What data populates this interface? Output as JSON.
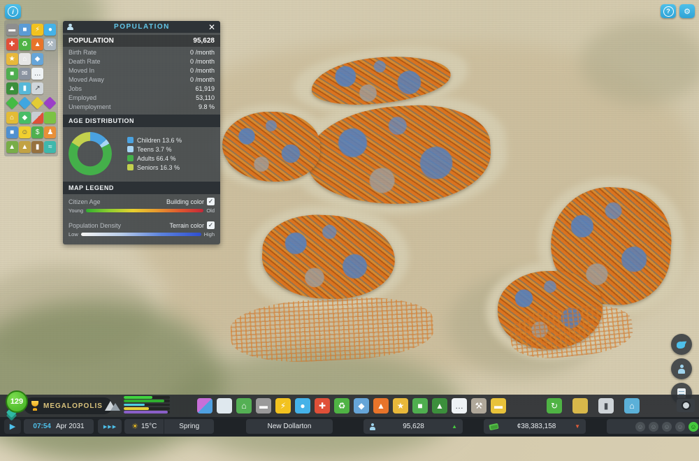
{
  "accent": "#3fb6e3",
  "icons": {
    "info": "i",
    "help": "?",
    "settings": "⚙",
    "close": "✕",
    "play": "▶",
    "sun": "☀",
    "up": "▲",
    "down": "▼",
    "check": "✓",
    "smiley": "☺"
  },
  "panel": {
    "title": "POPULATION",
    "stats": [
      {
        "label": "POPULATION",
        "value": "95,628",
        "emphasis": true
      },
      {
        "label": "Birth Rate",
        "value": "0 /month"
      },
      {
        "label": "Death Rate",
        "value": "0 /month"
      },
      {
        "label": "Moved In",
        "value": "0 /month"
      },
      {
        "label": "Moved Away",
        "value": "0 /month"
      },
      {
        "label": "Jobs",
        "value": "61,919"
      },
      {
        "label": "Employed",
        "value": "53,110"
      },
      {
        "label": "Unemployment",
        "value": "9.8 %"
      }
    ],
    "age_section_title": "AGE DISTRIBUTION",
    "map_legend_title": "MAP LEGEND",
    "citizen_age": {
      "label": "Citizen Age",
      "toggle_label": "Building color",
      "checked": true,
      "min": "Young",
      "max": "Old"
    },
    "population_density": {
      "label": "Population Density",
      "toggle_label": "Terrain color",
      "checked": true,
      "min": "Low",
      "max": "High"
    }
  },
  "chart_data": {
    "type": "pie",
    "title": "AGE DISTRIBUTION",
    "segments": [
      {
        "label": "Children",
        "value": 13.6,
        "value_text": "13.6 %",
        "color": "#4aa2e0"
      },
      {
        "label": "Teens",
        "value": 3.7,
        "value_text": "3.7 %",
        "color": "#a9d6f5"
      },
      {
        "label": "Adults",
        "value": 66.4,
        "value_text": "66.4 %",
        "color": "#44b04a"
      },
      {
        "label": "Seniors",
        "value": 16.3,
        "value_text": "16.3 %",
        "color": "#c3d14d"
      }
    ]
  },
  "infoview_toolbar": {
    "items": [
      {
        "name": "roads-infoview",
        "color": "#8e8e8e",
        "glyph": "▬"
      },
      {
        "name": "electronics-infoview",
        "color": "#5b9bd5",
        "glyph": "■"
      },
      {
        "name": "electricity-infoview",
        "color": "#f2c21f",
        "glyph": "⚡"
      },
      {
        "name": "water-infoview",
        "color": "#45b2e8",
        "glyph": "●"
      },
      {
        "name": "healthcare-infoview",
        "color": "#e05038",
        "glyph": "✚"
      },
      {
        "name": "garbage-infoview",
        "color": "#4fb344",
        "glyph": "♻"
      },
      {
        "name": "fire-infoview",
        "color": "#e8742a",
        "glyph": "▲"
      },
      {
        "name": "maintenance-infoview",
        "color": "#aab6bf",
        "glyph": "⚒"
      },
      {
        "name": "police-infoview",
        "color": "#e8b83a",
        "glyph": "★"
      },
      {
        "name": "administration-infoview",
        "color": "#e6e6e6",
        "glyph": "⌂"
      },
      {
        "name": "education-infoview",
        "color": "#66a5d8",
        "glyph": "◆"
      },
      {
        "empty": true
      },
      {
        "name": "transportation-infoview",
        "color": "#4fae4f",
        "glyph": "■"
      },
      {
        "name": "post-infoview",
        "color": "#8a93a0",
        "glyph": "✉"
      },
      {
        "name": "telecom-infoview",
        "color": "#eef2f4",
        "glyph": "…",
        "dark": true
      },
      {
        "empty": true
      },
      {
        "name": "parks-infoview",
        "color": "#3c8f3c",
        "glyph": "▲"
      },
      {
        "name": "battery-infoview",
        "color": "#56b8d8",
        "glyph": "▮"
      },
      {
        "name": "outside-connections-infoview",
        "color": "#d0d6da",
        "glyph": "↗",
        "dark": true
      },
      {
        "empty": true
      },
      {
        "name": "land-map-infoview",
        "color": "#44bb44",
        "shape": "diamond"
      },
      {
        "name": "water-map-infoview",
        "color": "#3fa6e0",
        "shape": "diamond"
      },
      {
        "name": "pollution-map-infoview",
        "color": "#e3cc35",
        "shape": "diamond"
      },
      {
        "name": "noise-map-infoview",
        "color": "#9b3fc8",
        "shape": "diamond"
      },
      {
        "name": "residential-infoview",
        "color": "#e3bb35",
        "glyph": "⌂"
      },
      {
        "name": "land-value-infoview",
        "color": "#48bd66",
        "glyph": "◆"
      },
      {
        "name": "growth-infoview",
        "color": "#c8cdd2",
        "color2": "#e05038",
        "glyph": ""
      },
      {
        "name": "greenery-infoview",
        "color": "#7cc244",
        "glyph": ""
      },
      {
        "name": "tourism-infoview",
        "color": "#5090d0",
        "glyph": "■"
      },
      {
        "name": "happiness-infoview",
        "color": "#f0cf2f",
        "glyph": "☺",
        "dark": true
      },
      {
        "name": "economy-infoview",
        "color": "#4fb04f",
        "glyph": "$"
      },
      {
        "name": "population-infoview",
        "color": "#e89038",
        "glyph": "♟"
      },
      {
        "name": "terrain-infoview",
        "color": "#78ad48",
        "glyph": "▲"
      },
      {
        "name": "desert-infoview",
        "color": "#c2a244",
        "glyph": "▲"
      },
      {
        "name": "resources-infoview",
        "color": "#96713f",
        "glyph": "▮"
      },
      {
        "name": "water-resources-infoview",
        "color": "#3fb8ac",
        "glyph": "≈"
      }
    ]
  },
  "bottom_toolbar": {
    "group1": [
      {
        "name": "zones-tool",
        "color": "#c86fd8",
        "color2": "#4fa0e0"
      },
      {
        "name": "zoning-tool",
        "color": "#dfe8ee",
        "shape": "diamond"
      },
      {
        "name": "signature-buildings-tool",
        "color": "#54b054",
        "glyph": "⌂"
      },
      {
        "name": "roads-tool",
        "color": "#9a9a9a",
        "glyph": "▬"
      },
      {
        "name": "electricity-tool",
        "color": "#f2c21f",
        "glyph": "⚡"
      },
      {
        "name": "water-tool",
        "color": "#45b2e8",
        "glyph": "●"
      },
      {
        "name": "healthcare-tool",
        "color": "#e05038",
        "glyph": "✚"
      },
      {
        "name": "garbage-tool",
        "color": "#4fb344",
        "glyph": "♻"
      },
      {
        "name": "education-tool",
        "color": "#66a5d8",
        "glyph": "◆"
      },
      {
        "name": "fire-tool",
        "color": "#e8742a",
        "glyph": "▲"
      },
      {
        "name": "police-tool",
        "color": "#e8b83a",
        "glyph": "★"
      },
      {
        "name": "transportation-tool",
        "color": "#4fae4f",
        "glyph": "■"
      },
      {
        "name": "parks-tool",
        "color": "#3c8f3c",
        "glyph": "▲"
      },
      {
        "name": "communications-tool",
        "color": "#eef2f4",
        "glyph": "…",
        "dark": true
      },
      {
        "name": "landscaping-tool",
        "color": "#b0a89a",
        "glyph": "⚒"
      },
      {
        "name": "bulldozer-tool",
        "color": "#e8c23a",
        "glyph": "▬"
      }
    ],
    "group2": [
      {
        "name": "economy-menu",
        "color": "#4fb344",
        "glyph": "↻"
      },
      {
        "name": "progression-menu",
        "color": "#d8b84a",
        "shape": "diamond"
      },
      {
        "name": "statistics-menu",
        "color": "#cfd4d8",
        "glyph": "▮",
        "dark": true
      },
      {
        "name": "city-services-menu",
        "color": "#5bb0d8",
        "glyph": "⌂"
      }
    ]
  },
  "progression": {
    "level": "129",
    "milestone": "MEGALOPOLIS"
  },
  "demand": {
    "bars": [
      {
        "name": "residential-low-demand",
        "color": "#3ed43e",
        "pct": 62
      },
      {
        "name": "residential-high-demand",
        "color": "#2fae2f",
        "pct": 88
      },
      {
        "name": "commercial-demand",
        "color": "#4ecfe0",
        "pct": 45
      },
      {
        "name": "industrial-demand",
        "color": "#e8cf3a",
        "pct": 55
      },
      {
        "name": "office-demand",
        "color": "#8a5fc8",
        "pct": 95
      }
    ]
  },
  "statusbar": {
    "time": "07:54",
    "date": "Apr 2031",
    "temperature": "15°C",
    "season": "Spring",
    "city_name": "New Dollarton",
    "population": "95,628",
    "money": "¢38,383,158"
  },
  "happiness": {
    "factors": [
      {
        "name": "happiness-factor-1"
      },
      {
        "name": "happiness-factor-2"
      },
      {
        "name": "happiness-factor-3"
      },
      {
        "name": "happiness-factor-4"
      }
    ]
  }
}
